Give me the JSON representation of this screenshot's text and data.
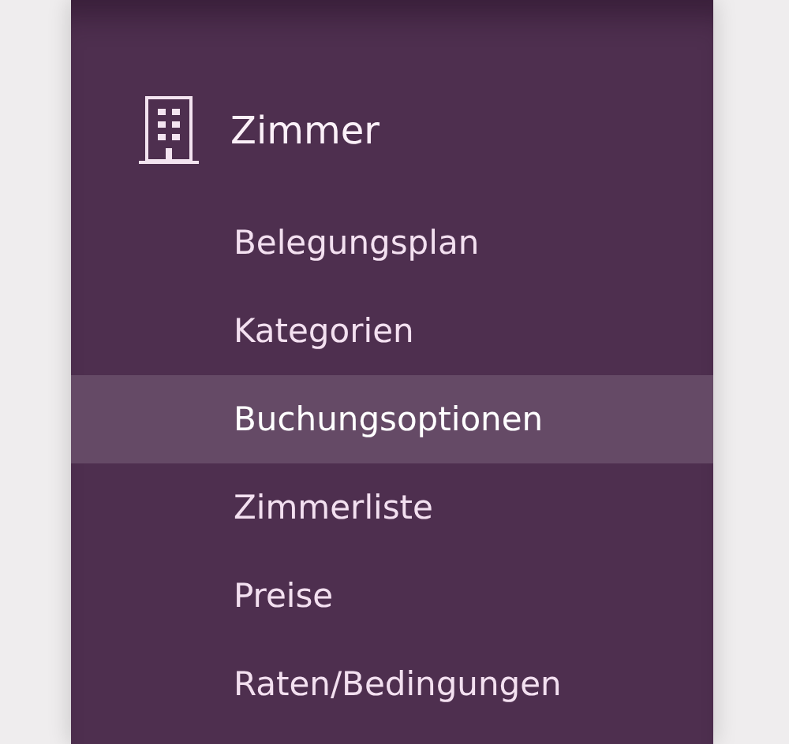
{
  "section": {
    "title": "Zimmer"
  },
  "items": [
    {
      "label": "Belegungsplan",
      "selected": false
    },
    {
      "label": "Kategorien",
      "selected": false
    },
    {
      "label": "Buchungsoptionen",
      "selected": true
    },
    {
      "label": "Zimmerliste",
      "selected": false
    },
    {
      "label": "Preise",
      "selected": false
    },
    {
      "label": "Raten/Bedingungen",
      "selected": false
    }
  ]
}
